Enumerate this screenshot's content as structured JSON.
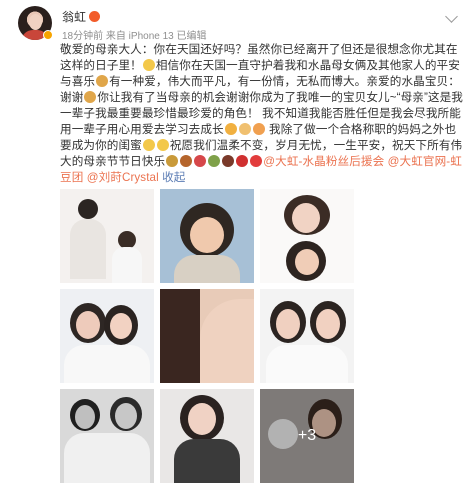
{
  "header": {
    "author": "翁虹",
    "meta": "18分钟前 来自 iPhone 13 已编辑"
  },
  "post": {
    "seg1": "敬爱的母亲大人：你在天国还好吗？虽然你已经离开了但还是很想念你尤其在这样的日子里！",
    "seg2": "相信你在天国一直守护着我和水晶母女俩及其他家人的平安与喜乐",
    "seg3": "有一种爱，伟大而平凡，有一份情，无私而博大。亲爱的水晶宝贝：谢谢",
    "seg4": "你让我有了当母亲的机会谢谢你成为了我唯一的宝贝女儿~“母亲”这是我一辈子我最重要最珍惜最珍爱的角色！",
    "seg5": "我不知道我能否胜任但是我会尽我所能用一辈子用心用爱去学习去成长",
    "seg6": "我除了做一个合格称职的妈妈之外也要成为你的闺蜜",
    "seg7": "祝愿我们温柔不变，岁月无忧，一生平安，祝天下所有伟大的母亲节节日快乐",
    "mention1": "@大虹-水晶粉丝后援会",
    "mention2": "@大虹官网-虹豆团",
    "mention3": "@刘莳Crystal",
    "end": "收起"
  },
  "grid": {
    "more_count": "+3"
  },
  "colors": {
    "link": "#eb7350",
    "text": "#333333",
    "meta": "#8f8f8f"
  }
}
